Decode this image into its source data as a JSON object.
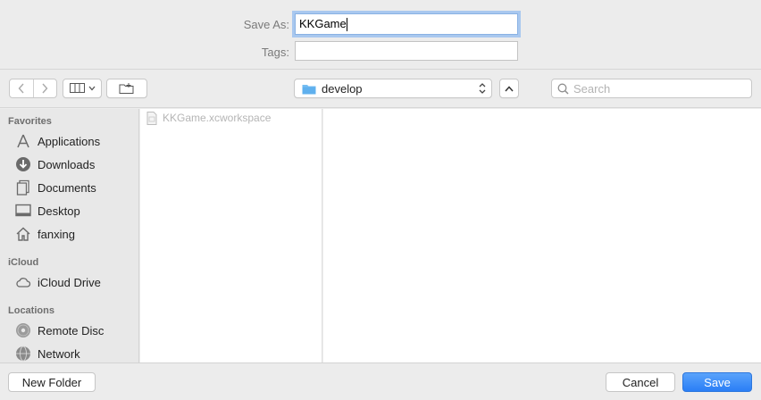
{
  "form": {
    "save_as_label": "Save As:",
    "save_as_value": "KKGame",
    "tags_label": "Tags:",
    "tags_value": ""
  },
  "toolbar": {
    "path_label": "develop",
    "search_placeholder": "Search"
  },
  "sidebar": {
    "sections": [
      {
        "title": "Favorites"
      },
      {
        "title": "iCloud"
      },
      {
        "title": "Locations"
      }
    ],
    "favorites": [
      {
        "label": "Applications",
        "icon": "applications-icon"
      },
      {
        "label": "Downloads",
        "icon": "downloads-icon"
      },
      {
        "label": "Documents",
        "icon": "documents-icon"
      },
      {
        "label": "Desktop",
        "icon": "desktop-icon"
      },
      {
        "label": "fanxing",
        "icon": "home-icon"
      }
    ],
    "icloud": [
      {
        "label": "iCloud Drive",
        "icon": "cloud-icon"
      }
    ],
    "locations": [
      {
        "label": "Remote Disc",
        "icon": "disc-icon"
      },
      {
        "label": "Network",
        "icon": "network-icon"
      }
    ]
  },
  "browser": {
    "files": [
      {
        "name": "KKGame.xcworkspace",
        "disabled": true
      }
    ]
  },
  "buttons": {
    "new_folder": "New Folder",
    "cancel": "Cancel",
    "save": "Save"
  },
  "colors": {
    "accent": "#2a7ef6",
    "focus_ring": "#a9c8ef",
    "folder": "#6fb8f2"
  }
}
